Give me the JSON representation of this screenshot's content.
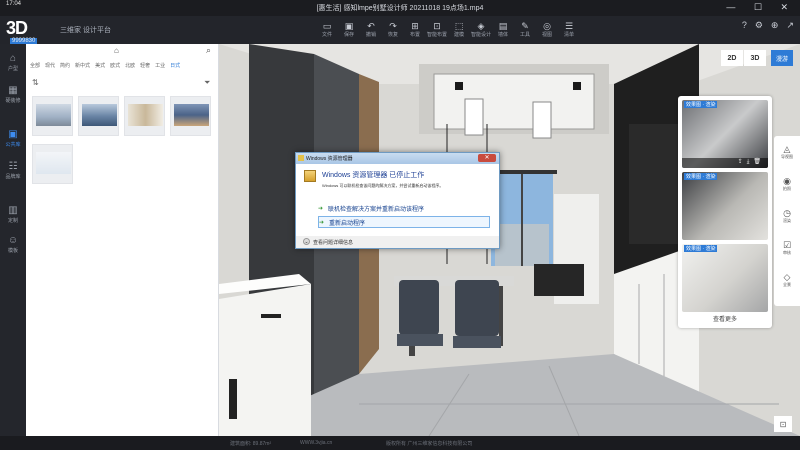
{
  "titlebar": {
    "clock": "17:04",
    "title": "[惠生活] 感知lmpe别墅设计师 20211018 19点场1.mp4",
    "window_controls": "—  ☐  ✕"
  },
  "toolbar": {
    "brand_mark": "3D",
    "brand_label": "9999830",
    "subtitle": "三维家 设计平台",
    "tools": [
      {
        "icon": "file-icon",
        "glyph": "▭",
        "label": "文件"
      },
      {
        "icon": "save-icon",
        "glyph": "▣",
        "label": "保存"
      },
      {
        "icon": "undo-icon",
        "glyph": "↶",
        "label": "撤销"
      },
      {
        "icon": "redo-icon",
        "glyph": "↷",
        "label": "恢复"
      },
      {
        "icon": "layout-icon",
        "glyph": "⊞",
        "label": "布置"
      },
      {
        "icon": "ai-layout-icon",
        "glyph": "⊡",
        "label": "智能布置"
      },
      {
        "icon": "model-icon",
        "glyph": "⬚",
        "label": "建模"
      },
      {
        "icon": "smart-design-icon",
        "glyph": "◈",
        "label": "智能设计"
      },
      {
        "icon": "wall-icon",
        "glyph": "▤",
        "label": "墙体"
      },
      {
        "icon": "tools-icon",
        "glyph": "✎",
        "label": "工具"
      },
      {
        "icon": "view-icon",
        "glyph": "◎",
        "label": "视图"
      },
      {
        "icon": "list-icon",
        "glyph": "☰",
        "label": "清单"
      }
    ],
    "right_tools": [
      "?",
      "⚙",
      "⊕",
      "↗"
    ],
    "share_label": "分享"
  },
  "rail": [
    {
      "icon": "home-icon",
      "glyph": "⌂",
      "label": "户型"
    },
    {
      "icon": "hard-decor-icon",
      "glyph": "▦",
      "label": "硬装修"
    },
    {
      "icon": "public-library-icon",
      "glyph": "▣",
      "label": "公共库",
      "active": true
    },
    {
      "icon": "my-library-icon",
      "glyph": "☷",
      "label": "品牌库"
    },
    {
      "icon": "custom-icon",
      "glyph": "▥",
      "label": "定制"
    },
    {
      "icon": "template-icon",
      "glyph": "☺",
      "label": "模板"
    }
  ],
  "panel": {
    "categories": [
      "全部",
      "现代",
      "简约",
      "新中式",
      "美式",
      "欧式",
      "北欧",
      "轻奢",
      "工业",
      "日式"
    ],
    "active_category": "日式"
  },
  "viewport": {
    "view_2d": "2D",
    "view_3d": "3D",
    "view_pano": "漫游"
  },
  "renders": {
    "tag": "效果图 · 渲染",
    "see_more": "查看更多"
  },
  "mini_rail": [
    {
      "icon": "navigator-icon",
      "glyph": "◬",
      "label": "导视图"
    },
    {
      "icon": "camera-icon",
      "glyph": "◉",
      "label": "拍照"
    },
    {
      "icon": "history-icon",
      "glyph": "◷",
      "label": "渲染"
    },
    {
      "icon": "check-icon",
      "glyph": "☑",
      "label": "审核"
    },
    {
      "icon": "vr-icon",
      "glyph": "◇",
      "label": "全景"
    }
  ],
  "corner_btn": "⊡",
  "status": {
    "area": "建筑面积: 89.87m²",
    "company": "WWW.3vjia.cn",
    "copyright": "版权所有 广州三维家信息科技有限公司"
  },
  "dialog": {
    "title": "Windows 资源管理器",
    "close": "✕",
    "heading": "Windows 资源管理器 已停止工作",
    "description": "Windows 可以联机检查该问题的解决方案，并尝试重新启动该程序。",
    "option1": "联机检查解决方案并重新启动该程序",
    "option2": "重新启动程序",
    "details": "查看问题详细信息"
  }
}
